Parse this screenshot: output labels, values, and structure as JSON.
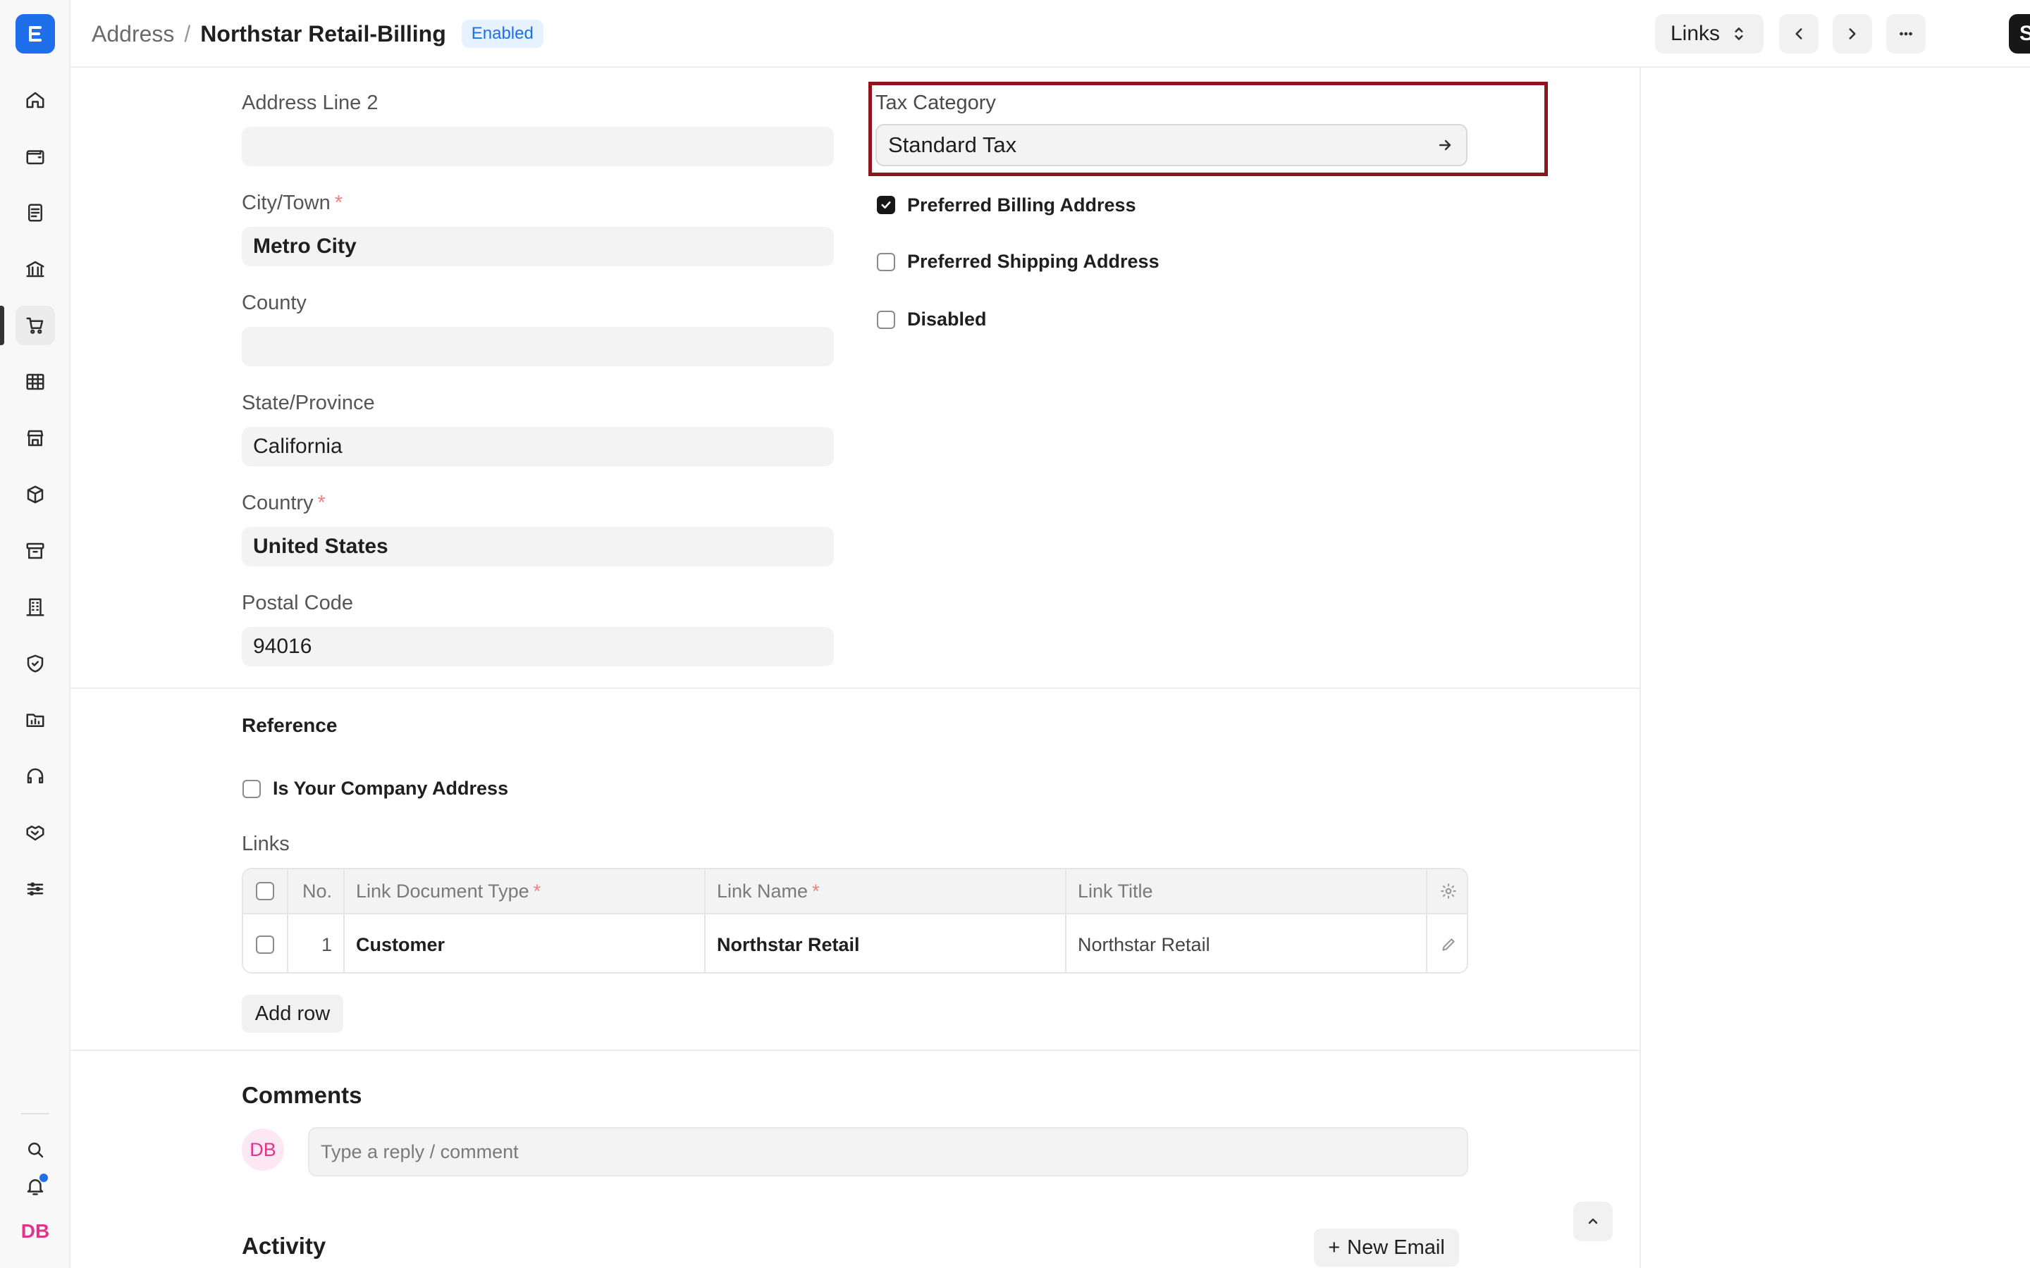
{
  "breadcrumb": {
    "parent": "Address",
    "separator": "/",
    "title": "Northstar Retail-Billing",
    "status": "Enabled"
  },
  "toolbar": {
    "links_label": "Links",
    "save_label": "Save"
  },
  "sidebar": {
    "icons": [
      "home-icon",
      "wallet-icon",
      "document-icon",
      "bank-icon",
      "cart-icon",
      "table-icon",
      "store-icon",
      "package-icon",
      "archive-icon",
      "building-icon",
      "shield-icon",
      "folder-chart-icon",
      "headset-icon",
      "handshake-icon",
      "sliders-icon"
    ],
    "bottom_icons": [
      "search-icon",
      "bell-icon"
    ],
    "user_initials": "DB"
  },
  "form": {
    "address_line_2": {
      "label": "Address Line 2",
      "value": ""
    },
    "city": {
      "label": "City/Town",
      "required": "*",
      "value": "Metro City"
    },
    "county": {
      "label": "County",
      "value": ""
    },
    "state": {
      "label": "State/Province",
      "value": "California"
    },
    "country": {
      "label": "Country",
      "required": "*",
      "value": "United States"
    },
    "postal_code": {
      "label": "Postal Code",
      "value": "94016"
    },
    "tax_category": {
      "label": "Tax Category",
      "value": "Standard Tax"
    },
    "preferred_billing": {
      "label": "Preferred Billing Address",
      "checked": true
    },
    "preferred_shipping": {
      "label": "Preferred Shipping Address",
      "checked": false
    },
    "disabled": {
      "label": "Disabled",
      "checked": false
    }
  },
  "reference": {
    "title": "Reference",
    "is_company_address": {
      "label": "Is Your Company Address",
      "checked": false
    },
    "links_label": "Links",
    "table": {
      "headers": {
        "no": "No.",
        "doc_type": "Link Document Type",
        "link_name": "Link Name",
        "link_title": "Link Title",
        "required": "*"
      },
      "rows": [
        {
          "no": "1",
          "doc_type": "Customer",
          "link_name": "Northstar Retail",
          "link_title": "Northstar Retail"
        }
      ]
    },
    "add_row_label": "Add row"
  },
  "comments": {
    "title": "Comments",
    "avatar": "DB",
    "placeholder": "Type a reply / comment"
  },
  "activity": {
    "title": "Activity",
    "new_email_label": "New Email",
    "new_email_prefix": "+"
  }
}
